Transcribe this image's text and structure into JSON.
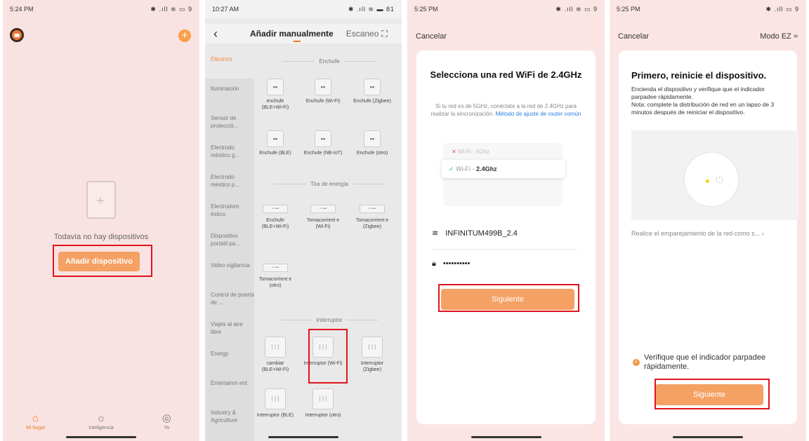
{
  "colors": {
    "accent": "#f4a163",
    "highlight": "#e0141b",
    "link": "#2b7de0"
  },
  "panel1": {
    "status": {
      "time": "5:24 PM",
      "icons": "✱ .ıll ≋ ▭ 9"
    },
    "empty_text": "Todavía no hay dispositivos",
    "add_button": "Añadir dispositivo",
    "tabs": [
      {
        "label": "Mi hogar",
        "icon": "home-icon"
      },
      {
        "label": "Inteligencia",
        "icon": "sun-icon"
      },
      {
        "label": "Yo",
        "icon": "user-icon"
      }
    ]
  },
  "panel2": {
    "status": {
      "time": "10:27 AM",
      "icons": "✱ .ıll ≋ ▬ 81"
    },
    "title": "Añadir manualmente",
    "title2": "Escaneo",
    "categories": [
      "Eléctrico",
      "Iluminación",
      "Sensor de protecció...",
      "Electrodo méstico g...",
      "Electrodo méstico p...",
      "Electrodom éstico",
      "Dispositivo portátil pa...",
      "Video vigilancia",
      "Control de puerta de ...",
      "Viajes al aire libre",
      "Energy",
      "Entertainm ent",
      "Industry & Agriculture"
    ],
    "sections": {
      "enchufe": "Enchufe",
      "tira": "Tira de energía",
      "interruptor": "Interruptor"
    },
    "devices": {
      "e1": "enchufe (BLE+Wi-Fi)",
      "e2": "Enchufe (Wi-Fi)",
      "e3": "Enchufe (Zigbee)",
      "e4": "Enchufe (BLE)",
      "e5": "Enchufe (NB-IoT)",
      "e6": "Enchufe (otro)",
      "t1": "Enchufe (BLE+Wi-Fi)",
      "t2": "Tomacorrient e (Wi-Fi)",
      "t3": "Tomacorrient e (Zigbee)",
      "t4": "Tomacorrient e (otro)",
      "i1": "cambiar (BLE+Wi-Fi)",
      "i2": "Interruptor (Wi-Fi)",
      "i3": "Interruptor (Zigbee)",
      "i4": "Interruptor (BLE)",
      "i5": "Interruptor (otro)"
    }
  },
  "panel3": {
    "status": {
      "time": "5:25 PM",
      "icons": "✱ .ıll ≋ ▭ 9"
    },
    "cancel": "Cancelar",
    "title": "Selecciona una red WiFi de 2.4GHz",
    "desc": "Si tu red es de 5GHz, conéctate a la red de 2.4GHz para realizar la sincronización.",
    "desc_link": "Método de ajuste de router común",
    "wifi5": "Wi-Fi - 5Ghz",
    "wifi24_prefix": "Wi-Fi - ",
    "wifi24": "2.4Ghz",
    "ssid": "INFINITUM499B_2.4",
    "password": "••••••••••",
    "next": "Siguiente"
  },
  "panel4": {
    "status": {
      "time": "5:25 PM",
      "icons": "✱ .ıll ▭ 9"
    },
    "cancel": "Cancelar",
    "mode": "Modo EZ ≈",
    "title": "Primero, reinicie el dispositivo.",
    "desc1": "Encienda el dispositivo y verifique que el indicador parpadee rápidamente.",
    "desc2": "Nota: complete la distribución de red en un lapso de 3 minutos después de reiniciar el dispositivo.",
    "link": "Realice el emparejamiento de la red como s...",
    "check": "Verifique que el indicador parpadee rápidamente.",
    "next": "Siguiente"
  }
}
